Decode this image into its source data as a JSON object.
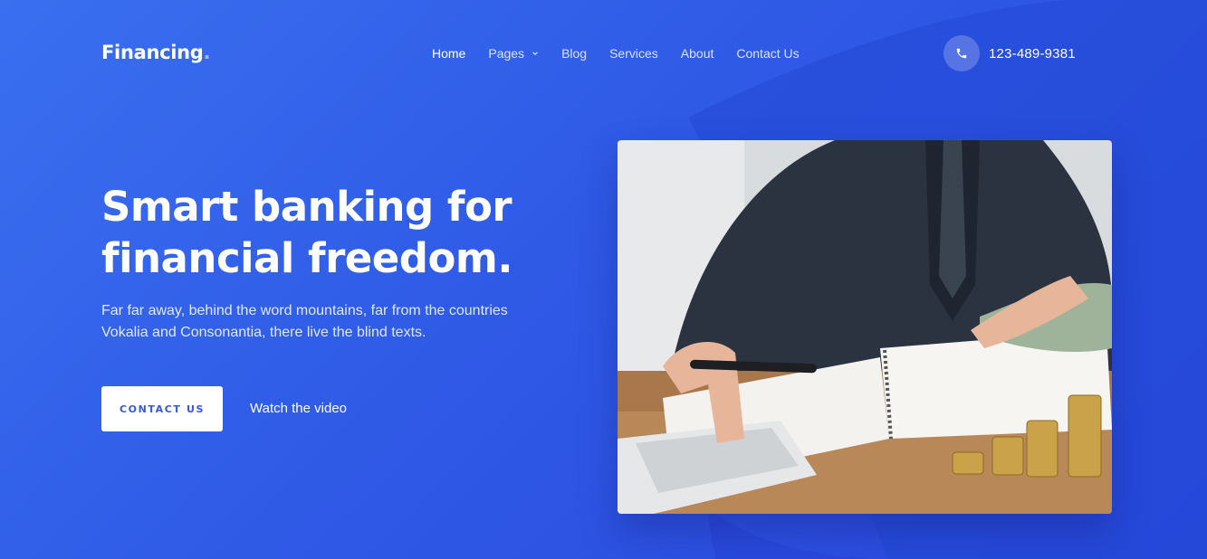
{
  "brand": {
    "name": "Financing",
    "dot": "."
  },
  "nav": {
    "items": [
      {
        "label": "Home",
        "active": true
      },
      {
        "label": "Pages",
        "dropdown": true
      },
      {
        "label": "Blog"
      },
      {
        "label": "Services"
      },
      {
        "label": "About"
      },
      {
        "label": "Contact Us"
      }
    ]
  },
  "contact": {
    "phone": "123-489-9381",
    "icon": "phone-icon"
  },
  "hero": {
    "title_line1": "Smart banking for",
    "title_line2": "financial freedom.",
    "text_line1": "Far far away, behind the word mountains, far from the countries",
    "text_line2": "Vokalia and Consonantia, there live the blind texts.",
    "cta_label": "CONTACT US",
    "video_label": "Watch the video",
    "image_subject": "businessman at desk with calculator, pen, notebook, banknotes and coin stacks"
  },
  "colors": {
    "accent": "#2f5ae6",
    "button_text": "#3558de",
    "white": "#ffffff"
  }
}
